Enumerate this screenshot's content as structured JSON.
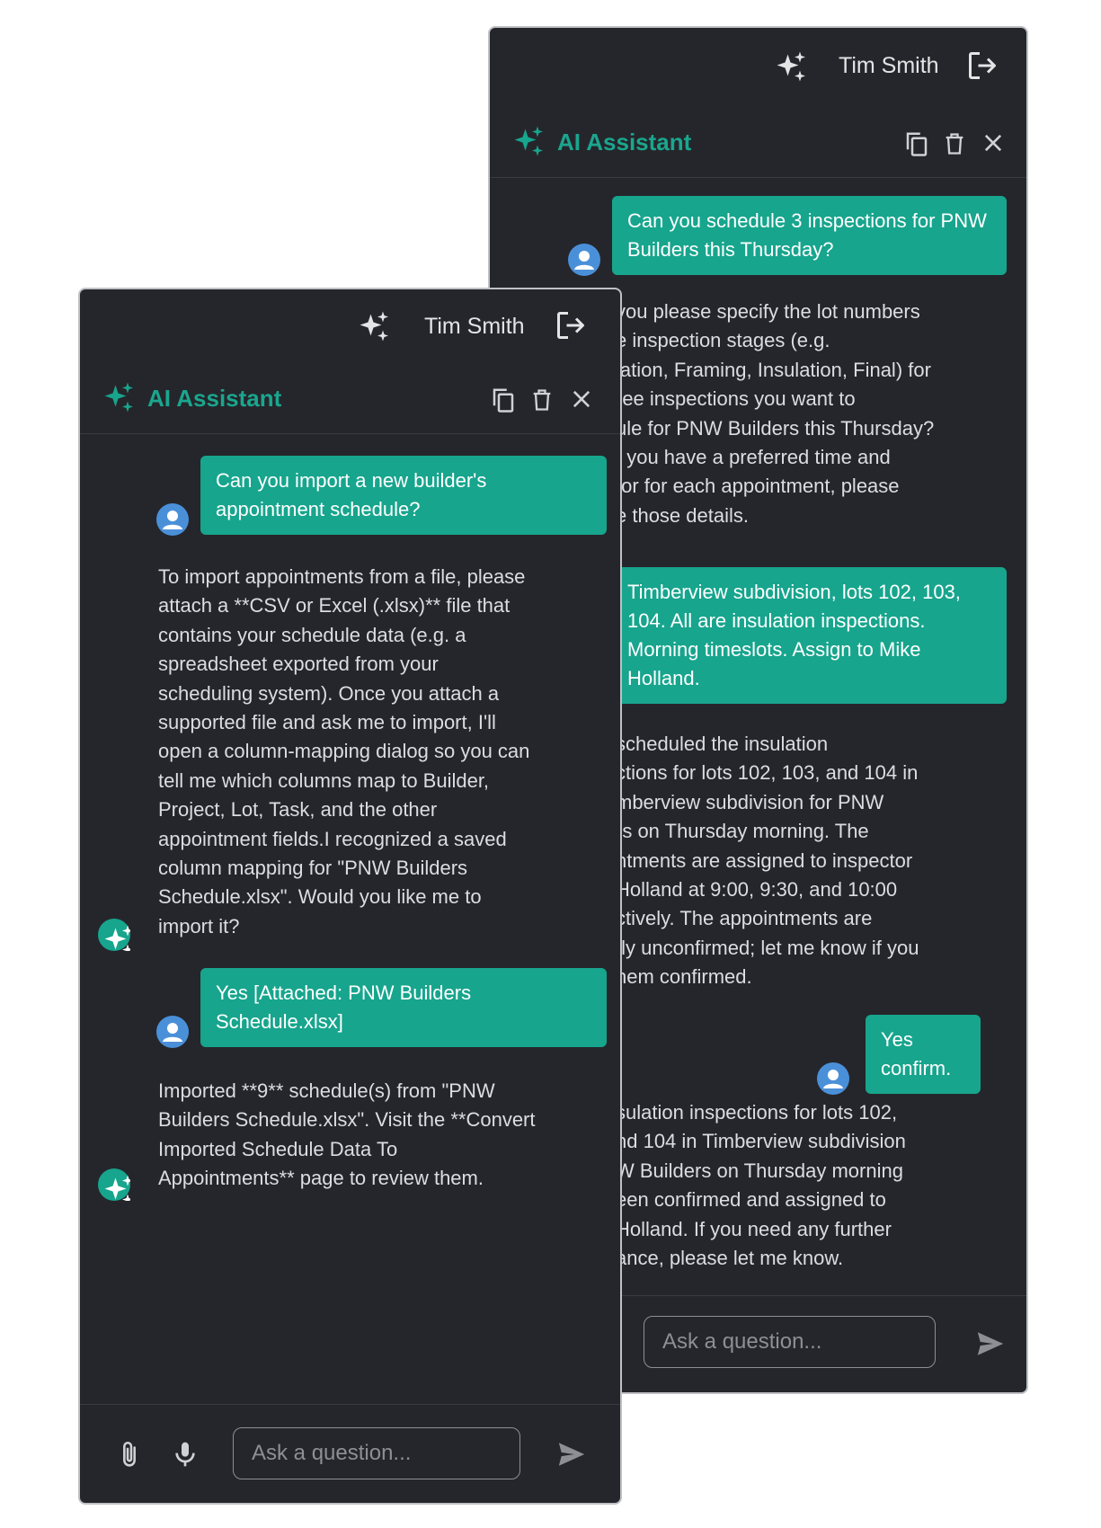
{
  "colors": {
    "accent": "#17a58d",
    "panel_bg": "#25262b",
    "avatar_blue": "#4a90d9"
  },
  "back_panel": {
    "user_name": "Tim Smith",
    "title": "AI Assistant",
    "messages": {
      "m1": "Can you schedule 3 inspections for PNW Builders this Thursday?",
      "m2": "you please specify the lot numbers\ne inspection stages (e.g.\nlation, Framing, Insulation, Final) for\nree inspections you want to\nule for PNW Builders this Thursday?\nf you have a preferred time and\ntor for each appointment, please\ne those details.",
      "m3": "Timberview subdivision, lots 102, 103, 104. All are insulation inspections. Morning timeslots. Assign to Mike Holland.",
      "m4": "scheduled the insulation\nctions for lots 102, 103, and 104 in\nmberview subdivision for PNW\nrs on Thursday morning. The\nntments are assigned to inspector\nHolland at 9:00, 9:30, and 10:00\nctively. The appointments are\ntly unconfirmed; let me know if you\nhem confirmed.",
      "m5": "Yes confirm.",
      "m6": "sulation inspections for lots 102,\nnd 104 in Timberview subdivision\nW Builders on Thursday morning\neen confirmed and assigned to\nHolland. If you need any further\nance, please let me know."
    },
    "input_placeholder": "Ask a question..."
  },
  "front_panel": {
    "user_name": "Tim Smith",
    "title": "AI Assistant",
    "messages": {
      "m1": "Can you import a new builder's appointment schedule?",
      "m2": "To import appointments from a file, please attach a **CSV or Excel (.xlsx)** file that contains your schedule data (e.g. a spreadsheet exported from your scheduling system). Once you attach a supported file and ask me to import, I'll open a column-mapping dialog so you can tell me which columns map to Builder, Project, Lot, Task, and the other appointment fields.I recognized a saved column mapping for \"PNW Builders Schedule.xlsx\". Would you like me to import it?",
      "m3": "Yes [Attached: PNW Builders Schedule.xlsx]",
      "m4": "Imported **9** schedule(s) from \"PNW Builders Schedule.xlsx\". Visit the **Convert Imported Schedule Data To Appointments** page to review them."
    },
    "input_placeholder": "Ask a question..."
  }
}
